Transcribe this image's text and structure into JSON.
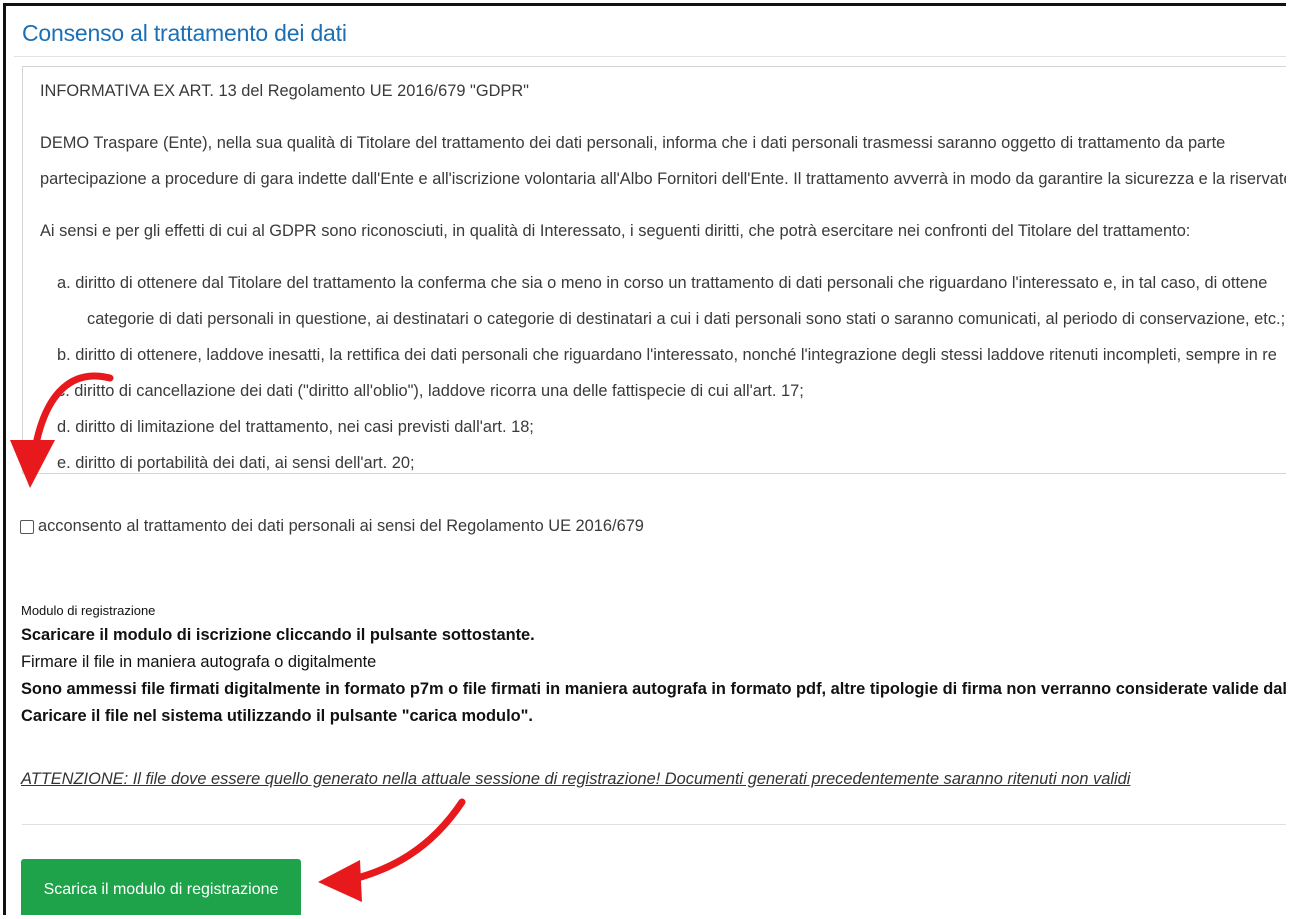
{
  "page_title": "Consenso al trattamento dei dati",
  "informativa": {
    "heading": "INFORMATIVA EX ART. 13 del Regolamento UE 2016/679 \"GDPR\"",
    "para1_line1": "DEMO Traspare (Ente), nella sua qualità di Titolare del trattamento dei dati personali, informa che i dati personali trasmessi saranno oggetto di trattamento da parte",
    "para1_line2": "partecipazione a procedure di gara indette dall'Ente e all'iscrizione volontaria all'Albo Fornitori dell'Ente. Il trattamento avverrà in modo da garantire la sicurezza e la riservatez",
    "para2": "Ai sensi e per gli effetti di cui al GDPR sono riconosciuti, in qualità di Interessato, i seguenti diritti, che potrà esercitare nei confronti del Titolare del trattamento:",
    "item_a_line1": "a. diritto di ottenere dal Titolare del trattamento la conferma che sia o meno in corso un trattamento di dati personali che riguardano l'interessato e, in tal caso, di ottene",
    "item_a_line2": "categorie di dati personali in questione, ai destinatari o categorie di destinatari a cui i dati personali sono stati o saranno comunicati, al periodo di conservazione, etc.;",
    "item_b": "b. diritto di ottenere, laddove inesatti, la rettifica dei dati personali che riguardano l'interessato, nonché l'integrazione degli stessi laddove ritenuti incompleti, sempre in re",
    "item_c": "c. diritto di cancellazione dei dati (\"diritto all'oblio\"), laddove ricorra una delle fattispecie di cui all'art. 17;",
    "item_d": "d. diritto di limitazione del trattamento, nei casi previsti dall'art. 18;",
    "item_e": "e. diritto di portabilità dei dati, ai sensi dell'art. 20;"
  },
  "consent": {
    "label": "acconsento al trattamento dei dati personali ai sensi del Regolamento UE 2016/679",
    "checked": false
  },
  "registration": {
    "title": "Modulo di registrazione",
    "line1": "Scaricare il modulo di iscrizione cliccando il pulsante sottostante.",
    "line2": "Firmare il file in maniera autografa o digitalmente",
    "line3": "Sono ammessi file firmati digitalmente in formato p7m o file firmati in maniera autografa in formato pdf, altre tipologie di firma non verranno considerate valide dal sistema",
    "line4": "Caricare il file nel sistema utilizzando il pulsante \"carica modulo\".",
    "warning": "ATTENZIONE: Il file dove essere quello generato nella attuale sessione di registrazione! Documenti generati precedentemente saranno ritenuti non validi"
  },
  "download_button": "Scarica il modulo di registrazione",
  "colors": {
    "title": "#1a6fb5",
    "button": "#1fa34a",
    "annotation_arrow": "#e8191c"
  }
}
